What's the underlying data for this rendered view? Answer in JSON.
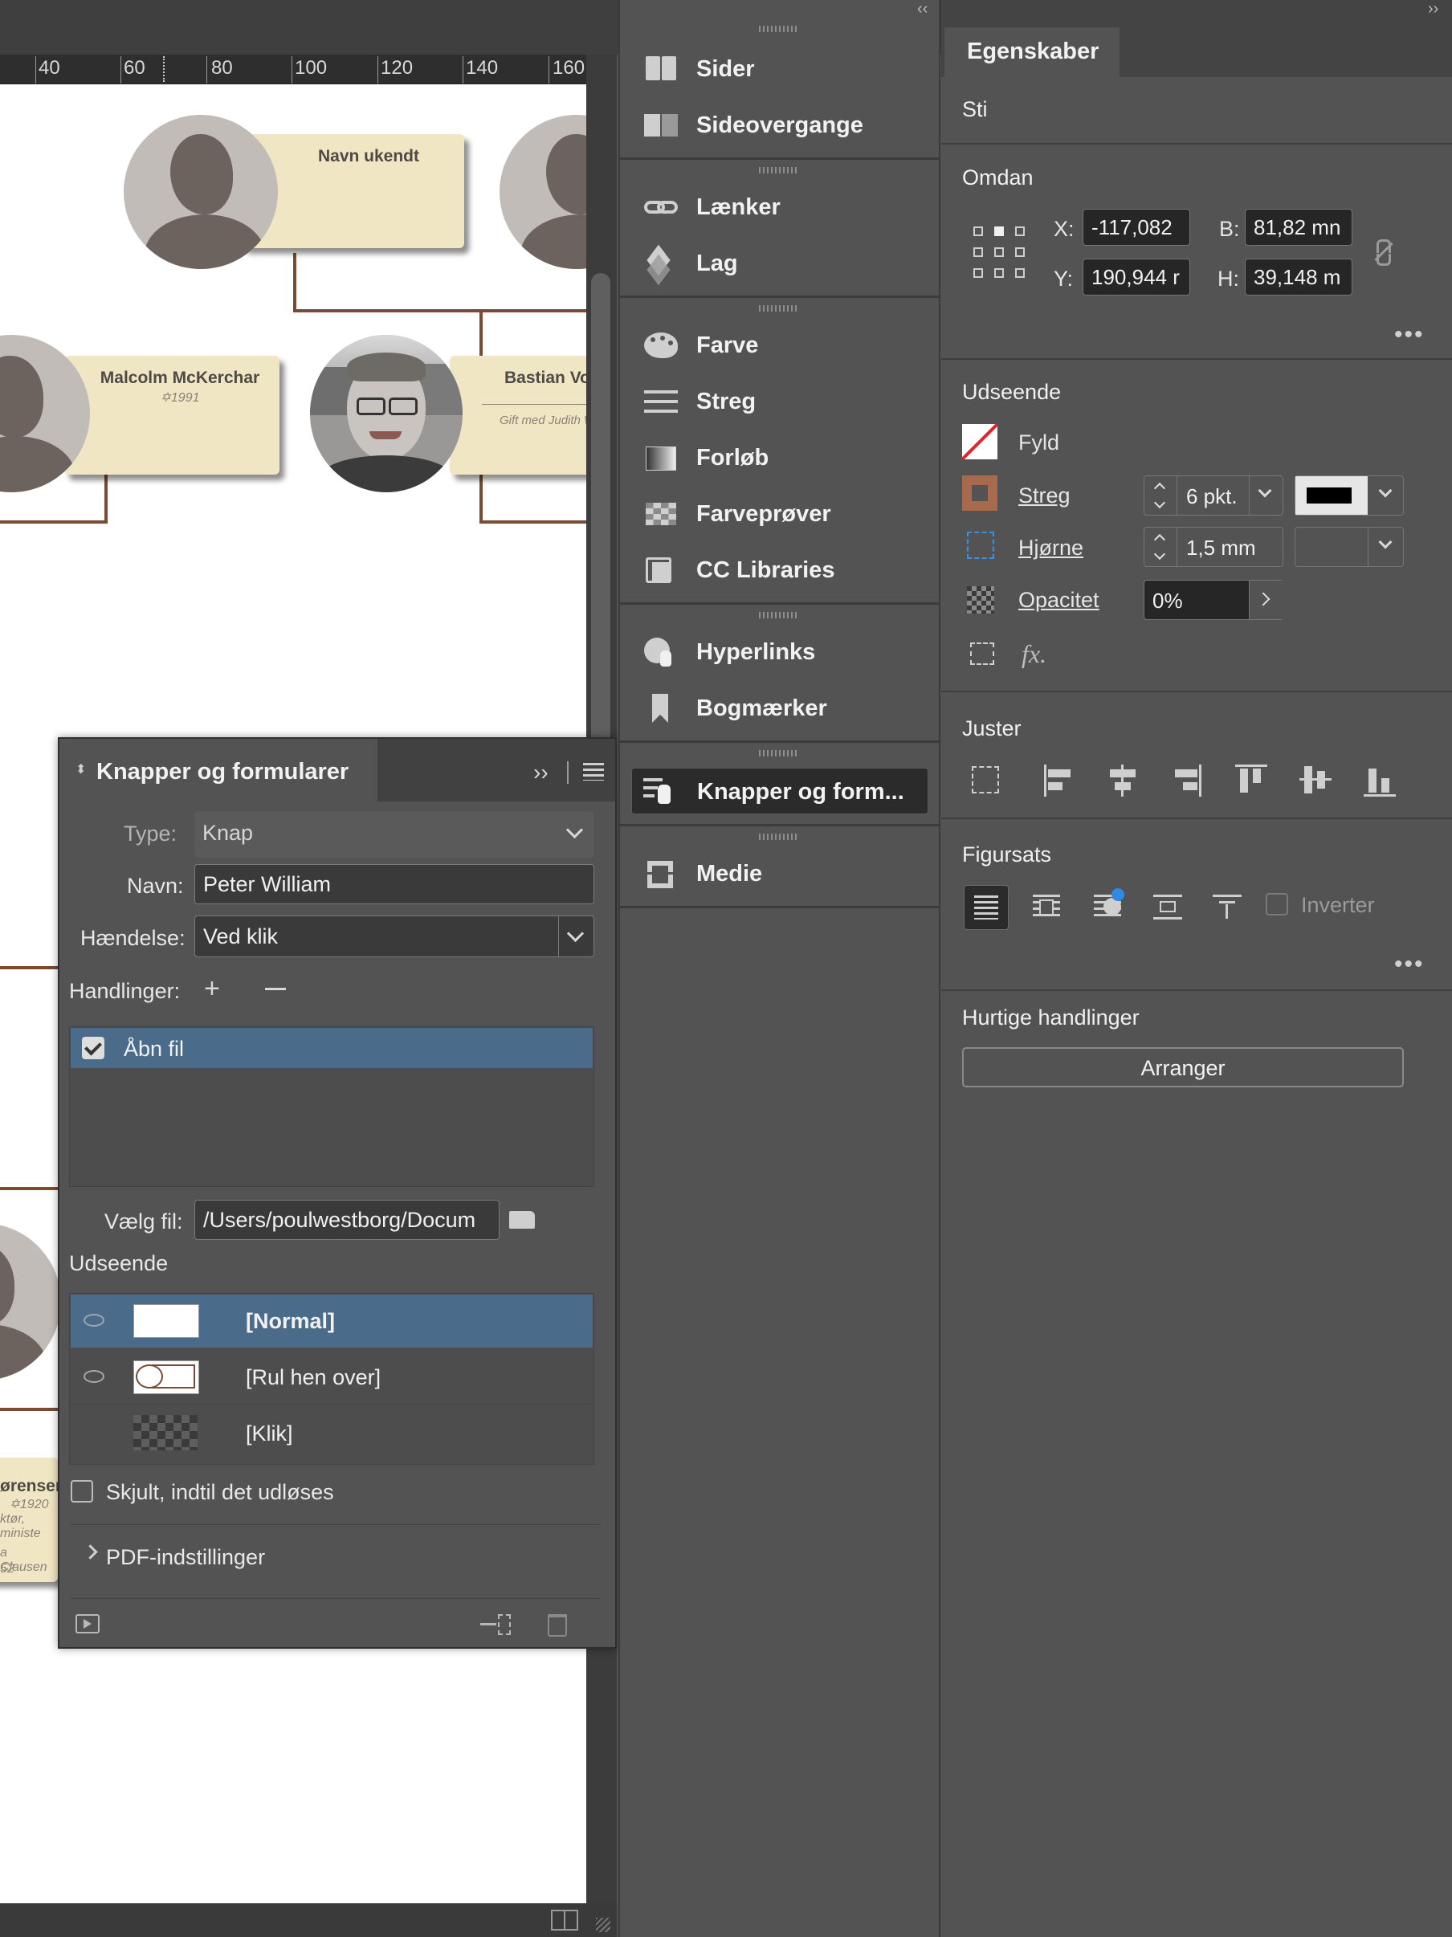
{
  "ruler": {
    "ticks": [
      "40",
      "60",
      "80",
      "100",
      "120",
      "140",
      "160"
    ]
  },
  "canvas": {
    "cards": [
      {
        "name": "Navn ukendt",
        "year": "",
        "note": ""
      },
      {
        "name": "Malcolm McKerchar",
        "year": "✡1991",
        "note": ""
      },
      {
        "name": "Bastian Vo",
        "year": "",
        "note": "Gift med Judith W"
      },
      {
        "name": "ørensen",
        "year": "✡1920",
        "note": "ktør, ministe",
        "note2": "a Clausen",
        "note3": "52"
      }
    ]
  },
  "dock": {
    "items": [
      {
        "label": "Sider",
        "icon": "pages-icon"
      },
      {
        "label": "Sideovergange",
        "icon": "page-transitions-icon"
      },
      {
        "label": "Lænker",
        "icon": "links-icon"
      },
      {
        "label": "Lag",
        "icon": "layers-icon"
      },
      {
        "label": "Farve",
        "icon": "color-palette-icon"
      },
      {
        "label": "Streg",
        "icon": "stroke-icon"
      },
      {
        "label": "Forløb",
        "icon": "gradient-icon"
      },
      {
        "label": "Farveprøver",
        "icon": "swatches-icon"
      },
      {
        "label": "CC Libraries",
        "icon": "cc-libraries-icon"
      },
      {
        "label": "Hyperlinks",
        "icon": "hyperlinks-icon"
      },
      {
        "label": "Bogmærker",
        "icon": "bookmarks-icon"
      },
      {
        "label": "Knapper og form...",
        "icon": "buttons-forms-icon",
        "active": true
      },
      {
        "label": "Medie",
        "icon": "media-icon"
      }
    ]
  },
  "properties": {
    "tab": "Egenskaber",
    "object_type": "Sti",
    "transform": {
      "title": "Omdan",
      "x_label": "X:",
      "x_value": "-117,082",
      "y_label": "Y:",
      "y_value": "190,944 r",
      "w_label": "B:",
      "w_value": "81,82 mn",
      "h_label": "H:",
      "h_value": "39,148 m"
    },
    "appearance": {
      "title": "Udseende",
      "fill_label": "Fyld",
      "stroke_label": "Streg",
      "stroke_weight": "6 pkt.",
      "corner_label": "Hjørne",
      "corner_value": "1,5 mm",
      "opacity_label": "Opacitet",
      "opacity_value": "0%",
      "fx_label": "fx."
    },
    "align": {
      "title": "Juster"
    },
    "text_wrap": {
      "title": "Figursats",
      "invert_label": "Inverter"
    },
    "quick_actions": {
      "title": "Hurtige handlinger",
      "arrange_label": "Arranger"
    },
    "colors": {
      "stroke_swatch": "#a86a4d",
      "stroke_color_box": "#000000"
    }
  },
  "buttons_panel": {
    "title": "Knapper og formularer",
    "type_label": "Type:",
    "type_value": "Knap",
    "name_label": "Navn:",
    "name_value": "Peter William",
    "event_label": "Hændelse:",
    "event_value": "Ved klik",
    "actions_label": "Handlinger:",
    "actions": [
      {
        "label": "Åbn fil",
        "checked": true
      }
    ],
    "choose_file_label": "Vælg fil:",
    "choose_file_value": "/Users/poulwestborg/Docum",
    "appearance_label": "Udseende",
    "states": [
      {
        "label": "[Normal]",
        "visible": true,
        "selected": true
      },
      {
        "label": "[Rul hen over]",
        "visible": true,
        "selected": false
      },
      {
        "label": "[Klik]",
        "visible": false,
        "selected": false
      }
    ],
    "hidden_until_triggered_label": "Skjult, indtil det udløses",
    "pdf_options_label": "PDF-indstillinger",
    "selection_color": "#4b6b8a"
  }
}
